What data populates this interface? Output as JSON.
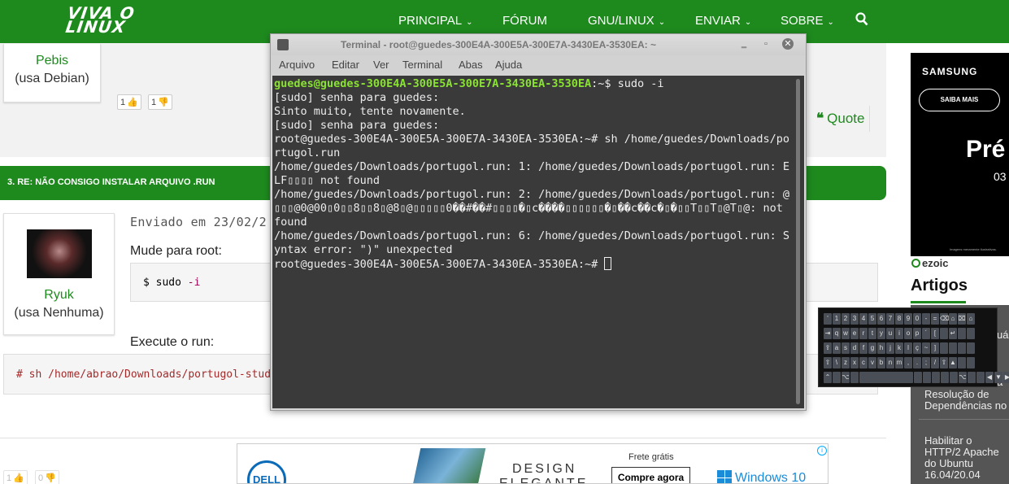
{
  "nav": {
    "logo": "VIVA O\nLINUX",
    "items": [
      {
        "label": "PRINCIPAL",
        "chev": "⌄"
      },
      {
        "label": "FÓRUM",
        "chev": ""
      },
      {
        "label": "GNU/LINUX",
        "chev": "⌄"
      },
      {
        "label": "ENVIAR",
        "chev": "⌄"
      },
      {
        "label": "SOBRE",
        "chev": "⌄"
      }
    ]
  },
  "post1": {
    "user": "Pebis",
    "distro": "(usa Debian)",
    "likes": "1",
    "dislikes": "1",
    "quote": "Quote"
  },
  "reply": {
    "title": "3. RE: NÃO CONSIGO INSTALAR ARQUIVO .RUN",
    "user": "Ryuk",
    "distro": "(usa Nenhuma)",
    "sent": "Enviado em 23/02/2",
    "text1": "Mude para root:",
    "code1_prompt": "$",
    "code1_cmd": "sudo",
    "code1_flag": "-i",
    "text2": "Execute o run:",
    "code2": "# sh /home/abrao/Downloads/portugol-stud"
  },
  "post3": {
    "likes": "1",
    "dislikes": "0"
  },
  "ads": {
    "bottom_shipping": "Frete grátis",
    "bottom_cta": "Compre agora",
    "bottom_brand": "DELL",
    "bottom_headline_1": "DESIGN",
    "bottom_headline_2": "ELEGANTE",
    "bottom_os": "Windows 10",
    "samsung_brand": "SAMSUNG",
    "samsung_cta": "SAIBA MAIS",
    "samsung_big": "Pré",
    "samsung_small": "03",
    "samsung_note": "Imagens meramente ilustrativas.",
    "ezoic": "ezoic"
  },
  "sidebar": {
    "heading": "Artigos",
    "items": [
      "Resolução de Dependências no",
      "Habilitar o HTTP/2 Apache do Ubuntu 16.04/20.04"
    ],
    "partial_right": [
      "uál",
      "a"
    ]
  },
  "terminal": {
    "title": "Terminal - root@guedes-300E4A-300E5A-300E7A-3430EA-3530EA: ~",
    "menu": [
      "Arquivo",
      "Editar",
      "Ver",
      "Terminal",
      "Abas",
      "Ajuda"
    ],
    "prompt_user": "guedes@guedes-300E4A-300E5A-300E7A-3430EA-3530EA",
    "prompt_rest": ":~$ sudo -i",
    "lines": [
      "[sudo] senha para guedes:",
      "Sinto muito, tente novamente.",
      "[sudo] senha para guedes:",
      "root@guedes-300E4A-300E5A-300E7A-3430EA-3530EA:~# sh /home/guedes/Downloads/portugol.run",
      "/home/guedes/Downloads/portugol.run: 1: /home/guedes/Downloads/portugol.run: ELF▯▯▯▯ not found",
      "/home/guedes/Downloads/portugol.run: 2: /home/guedes/Downloads/portugol.run: @▯▯▯@0@00▯0▯▯8▯▯8▯@8▯@▯▯▯▯▯0��#��#▯▯▯▯�▯c����▯▯▯▯▯▯�▯��c��c�▯�▯▯T▯▯T▯@T▯@: not found",
      "/home/guedes/Downloads/portugol.run: 6: /home/guedes/Downloads/portugol.run: Syntax error: \")\" unexpected",
      "root@guedes-300E4A-300E5A-300E7A-3430EA-3530EA:~# "
    ]
  },
  "keyboard": {
    "rows": [
      [
        "'",
        "1",
        "2",
        "3",
        "4",
        "5",
        "6",
        "7",
        "8",
        "9",
        "0",
        "-",
        "=",
        "⌫",
        "⌂",
        "⌧",
        "⌂"
      ],
      [
        "⇥",
        "q",
        "w",
        "e",
        "r",
        "t",
        "y",
        "u",
        "i",
        "o",
        "p",
        "´",
        "[",
        "",
        "↵",
        "",
        ""
      ],
      [
        "⇪",
        "a",
        "s",
        "d",
        "f",
        "g",
        "h",
        "j",
        "k",
        "l",
        "ç",
        "~",
        "]",
        "",
        "",
        "",
        ""
      ],
      [
        "⇧",
        "\\",
        "z",
        "x",
        "c",
        "v",
        "b",
        "n",
        "m",
        ",",
        ".",
        ";",
        "/",
        "⇧",
        "▲",
        "",
        ""
      ],
      [
        "⌃",
        "",
        "⌥",
        "",
        "",
        "",
        "",
        "",
        "",
        "",
        "⌥",
        "",
        "",
        "◀",
        "▼",
        "▶",
        ""
      ]
    ]
  },
  "colors": {
    "brand_green": "#1e8a1e",
    "terminal_bg": "#3a3a3a",
    "prompt_green": "#8ae234"
  }
}
